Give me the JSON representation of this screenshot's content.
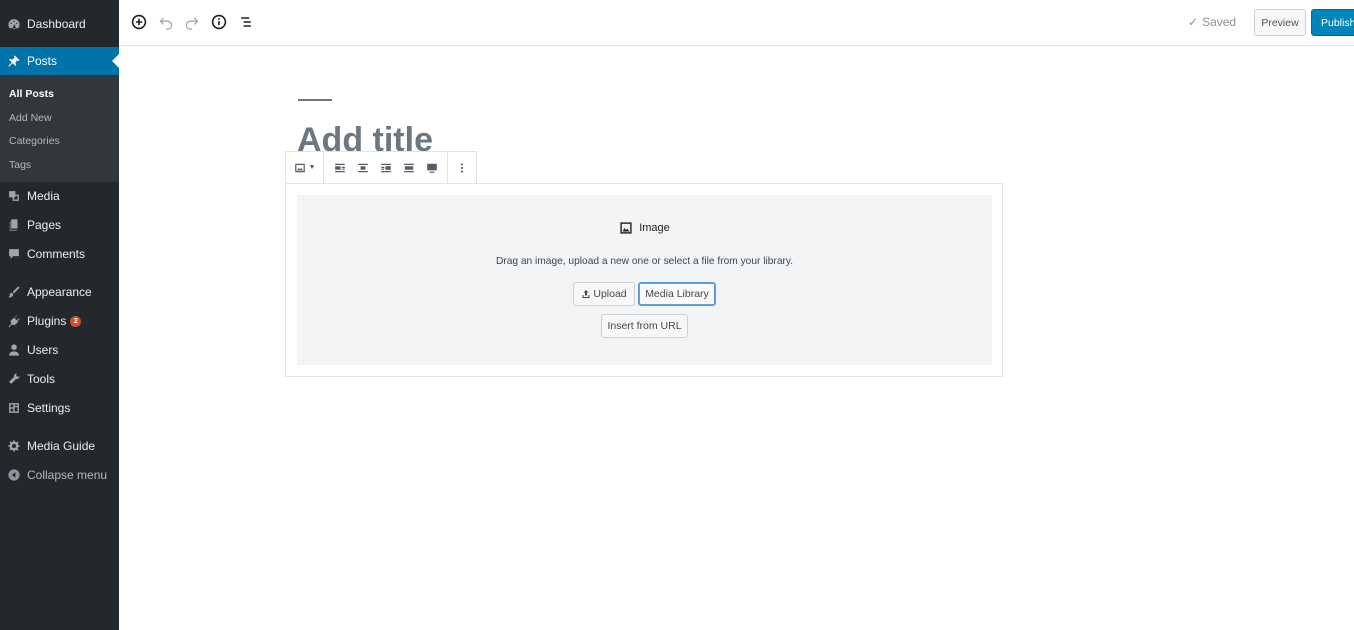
{
  "sidebar": {
    "dashboard": "Dashboard",
    "posts": "Posts",
    "submenu": [
      "All Posts",
      "Add New",
      "Categories",
      "Tags"
    ],
    "media": "Media",
    "pages": "Pages",
    "comments": "Comments",
    "appearance": "Appearance",
    "plugins": "Plugins",
    "plugins_badge": "2",
    "users": "Users",
    "tools": "Tools",
    "settings": "Settings",
    "media_guide": "Media Guide",
    "collapse": "Collapse menu"
  },
  "topbar": {
    "saved": "Saved",
    "preview": "Preview",
    "publish": "Publish..."
  },
  "editor": {
    "title_placeholder": "Add title",
    "image_block": {
      "label": "Image",
      "instructions": "Drag an image, upload a new one or select a file from your library.",
      "upload": "Upload",
      "media_library": "Media Library",
      "insert_url": "Insert from URL"
    }
  },
  "colors": {
    "sidebar_bg": "#23282d",
    "sidebar_active": "#0073aa",
    "publish_button": "#0085ba",
    "plugin_badge": "#d54e21"
  }
}
